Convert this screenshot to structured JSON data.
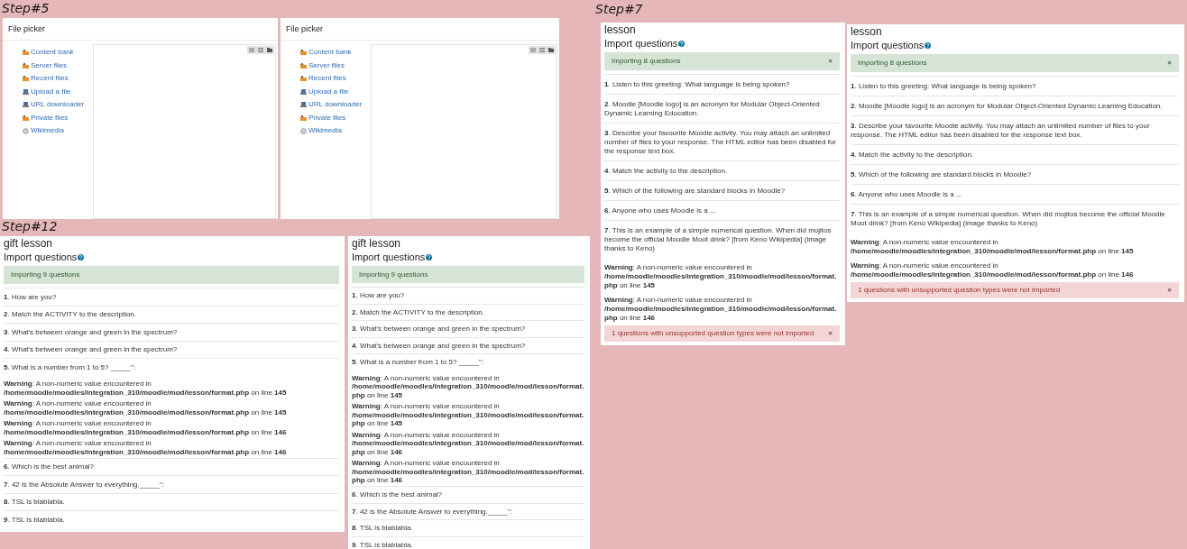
{
  "sections": [
    {
      "label": "Step#5",
      "panels": [
        {
          "kind": "file_picker",
          "title": "File picker",
          "items": [
            {
              "label": "Content bank",
              "kind": "repository"
            },
            {
              "label": "Server files",
              "kind": "repository"
            },
            {
              "label": "Recent files",
              "kind": "repository"
            },
            {
              "label": "Upload a file",
              "kind": "upload"
            },
            {
              "label": "URL downloader",
              "kind": "upload"
            },
            {
              "label": "Private files",
              "kind": "repository"
            },
            {
              "label": "Wikimedia",
              "kind": "globe"
            }
          ]
        },
        {
          "kind": "file_picker",
          "title": "File picker",
          "items": [
            {
              "label": "Content bank",
              "kind": "repository"
            },
            {
              "label": "Server files",
              "kind": "repository"
            },
            {
              "label": "Recent files",
              "kind": "repository"
            },
            {
              "label": "Upload a file",
              "kind": "upload"
            },
            {
              "label": "URL downloader",
              "kind": "upload"
            },
            {
              "label": "Private files",
              "kind": "repository"
            },
            {
              "label": "Wikimedia",
              "kind": "globe"
            }
          ]
        }
      ]
    },
    {
      "label": "Step#7",
      "panels": [
        {
          "kind": "import",
          "title": "lesson",
          "heading": "Import questions",
          "notice": {
            "text": "Importing 8 questions",
            "dismiss": "×"
          },
          "entries": [
            {
              "kind": "question",
              "text": "**1**. Listen to this greeting: What language is being spoken?"
            },
            {
              "kind": "question",
              "text": "**2**. Moodle [Moodle logo] is an acronym for Modular Object-Oriented Dynamic Learning Education."
            },
            {
              "kind": "question",
              "text": "**3**. Describe your favourite Moodle activity. You may attach an unlimited number of files to your response. The HTML editor has been disabled for the response text box."
            },
            {
              "kind": "question",
              "text": "**4**. Match the activity to the description."
            },
            {
              "kind": "question",
              "text": "**5**. Which of the following are standard blocks in Moodle?"
            },
            {
              "kind": "question",
              "text": "**6**. Anyone who uses Moodle is a ..."
            },
            {
              "kind": "question",
              "text": "**7**. This is an example of a simple numerical question. When did mojitos become the official Moodle Moot drink? [from Keno Wikipedia] (image thanks to Keno)"
            },
            {
              "kind": "warning",
              "text": "**Warning**: A non-numeric value encountered in **/home/moodle/moodles/integration_310/moodle/mod/lesson/format.php** on line **145**"
            },
            {
              "kind": "warning",
              "text": "**Warning**: A non-numeric value encountered in **/home/moodle/moodles/integration_310/moodle/mod/lesson/format.php** on line **146**"
            }
          ],
          "error": {
            "text": "1 questions with unsupported question types were not imported",
            "dismiss": "×"
          }
        },
        {
          "kind": "import",
          "title": "lesson",
          "heading": "Import questions",
          "notice": {
            "text": "Importing 8 questions",
            "dismiss": "×"
          },
          "entries": [
            {
              "kind": "question",
              "text": "**1**. Listen to this greeting: What language is being spoken?"
            },
            {
              "kind": "question",
              "text": "**2**. Moodle [Moodle logo] is an acronym for Modular Object-Oriented Dynamic Learning Education."
            },
            {
              "kind": "question",
              "text": "**3**. Describe your favourite Moodle activity. You may attach an unlimited number of files to your response. The HTML editor has been disabled for the response text box."
            },
            {
              "kind": "question",
              "text": "**4**. Match the activity to the description."
            },
            {
              "kind": "question",
              "text": "**5**. Which of the following are standard blocks in Moodle?"
            },
            {
              "kind": "question",
              "text": "**6**. Anyone who uses Moodle is a ..."
            },
            {
              "kind": "question",
              "text": "**7**. This is an example of a simple numerical question. When did mojitos become the official Moodle Moot drink? [from Keno Wikipedia] (image thanks to Keno)"
            },
            {
              "kind": "warning",
              "text": "**Warning**: A non-numeric value encountered in **/home/moodle/moodles/integration_310/moodle/mod/lesson/format.php** on line **145**"
            },
            {
              "kind": "warning",
              "text": "**Warning**: A non-numeric value encountered in **/home/moodle/moodles/integration_310/moodle/mod/lesson/format.php** on line **146**"
            }
          ],
          "error": {
            "text": "1 questions with unsupported question types were not imported",
            "dismiss": "×"
          }
        }
      ]
    },
    {
      "label": "Step#12",
      "panels": [
        {
          "kind": "import",
          "title": "gift lesson",
          "heading": "Import questions",
          "notice": {
            "text": "Importing 9 questions"
          },
          "entries": [
            {
              "kind": "question",
              "text": "**1**. How are you?"
            },
            {
              "kind": "question",
              "text": "**2**. Match the ACTIVITY to the description."
            },
            {
              "kind": "question",
              "text": "**3**. What's between orange and green in the spectrum?"
            },
            {
              "kind": "question",
              "text": "**4**. What's between orange and green in the spectrum?"
            },
            {
              "kind": "question",
              "text": "**5**. What is a number from 1 to 5? _____\":"
            },
            {
              "kind": "warning",
              "text": "**Warning**: A non-numeric value encountered in **/home/moodle/moodles/integration_310/moodle/mod/lesson/format.php** on line **145**"
            },
            {
              "kind": "warning",
              "text": "**Warning**: A non-numeric value encountered in **/home/moodle/moodles/integration_310/moodle/mod/lesson/format.php** on line **145**"
            },
            {
              "kind": "warning",
              "text": "**Warning**: A non-numeric value encountered in **/home/moodle/moodles/integration_310/moodle/mod/lesson/format.php** on line **146**"
            },
            {
              "kind": "warning",
              "text": "**Warning**: A non-numeric value encountered in **/home/moodle/moodles/integration_310/moodle/mod/lesson/format.php** on line **146**"
            },
            {
              "kind": "question",
              "text": "**6**. Which is the best animal?"
            },
            {
              "kind": "question",
              "text": "**7**. 42 is the Absolute Answer to everything._____\":"
            },
            {
              "kind": "question",
              "text": "**8**. TSL is blablabla."
            },
            {
              "kind": "question",
              "text": "**9**. TSL is blablabla."
            }
          ]
        },
        {
          "kind": "import",
          "title": "gift lesson",
          "heading": "Import questions",
          "notice": {
            "text": "Importing 9 questions"
          },
          "entries": [
            {
              "kind": "question",
              "text": "**1**. How are you?"
            },
            {
              "kind": "question",
              "text": "**2**. Match the ACTIVITY to the description."
            },
            {
              "kind": "question",
              "text": "**3**. What's between orange and green in the spectrum?"
            },
            {
              "kind": "question",
              "text": "**4**. What's between orange and green in the spectrum?"
            },
            {
              "kind": "question",
              "text": "**5**. What is a number from 1 to 5? _____\":"
            },
            {
              "kind": "warning",
              "text": "**Warning**: A non-numeric value encountered in **/home/moodle/moodles/integration_310/moodle/mod/lesson/format.php** on line **145**"
            },
            {
              "kind": "warning",
              "text": "**Warning**: A non-numeric value encountered in **/home/moodle/moodles/integration_310/moodle/mod/lesson/format.php** on line **145**"
            },
            {
              "kind": "warning",
              "text": "**Warning**: A non-numeric value encountered in **/home/moodle/moodles/integration_310/moodle/mod/lesson/format.php** on line **146**"
            },
            {
              "kind": "warning",
              "text": "**Warning**: A non-numeric value encountered in **/home/moodle/moodles/integration_310/moodle/mod/lesson/format.php** on line **146**"
            },
            {
              "kind": "question",
              "text": "**6**. Which is the best animal?"
            },
            {
              "kind": "question",
              "text": "**7**. 42 is the Absolute Answer to everything._____\":"
            },
            {
              "kind": "question",
              "text": "**8**. TSL is blablabla."
            },
            {
              "kind": "question",
              "text": "**9**. TSL is blablabla."
            }
          ]
        }
      ]
    }
  ]
}
